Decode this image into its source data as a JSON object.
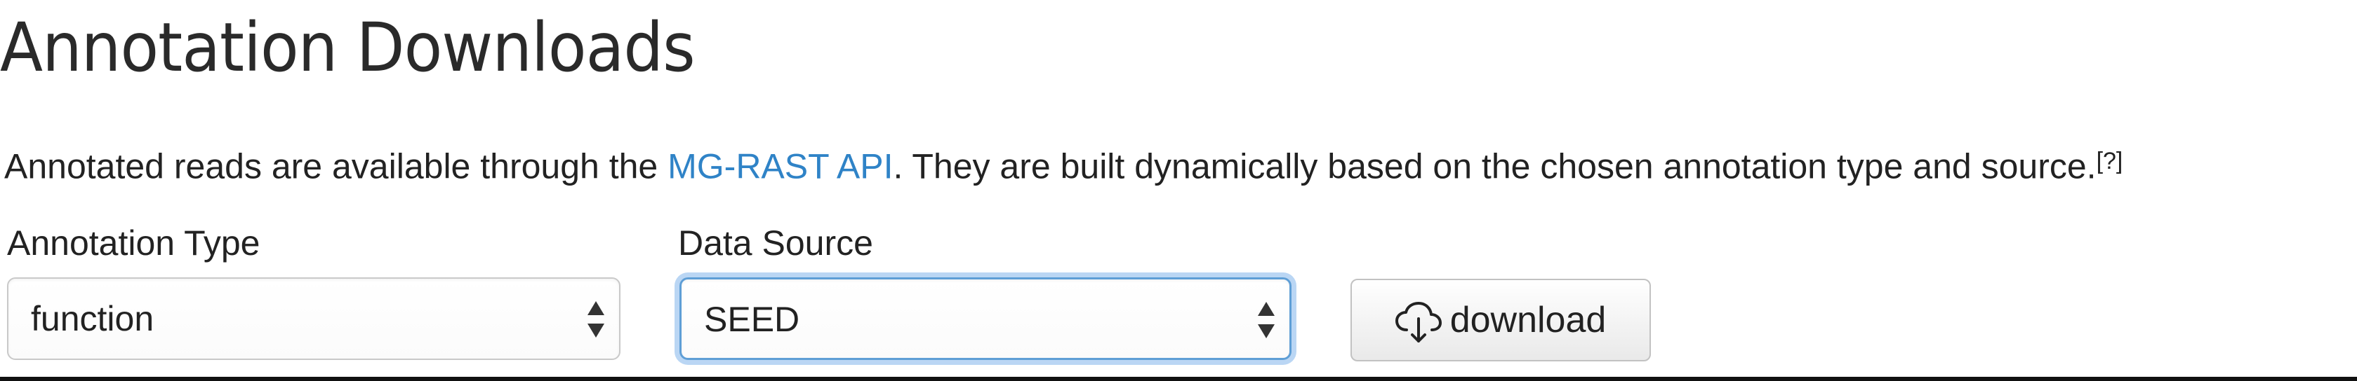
{
  "page_title": "Annotation Downloads",
  "description": {
    "before_link": "Annotated reads are available through the ",
    "link_text": "MG-RAST API",
    "after_link": ". They are built dynamically based on the chosen annotation type and source.",
    "footnote": "[?]"
  },
  "annotation_type": {
    "label": "Annotation Type",
    "selected": "function"
  },
  "data_source": {
    "label": "Data Source",
    "selected": "SEED"
  },
  "download_button": {
    "label": "download",
    "icon": "cloud-download-icon"
  },
  "colors": {
    "link": "#2f83c7",
    "focus_ring": "#66a5e6"
  }
}
